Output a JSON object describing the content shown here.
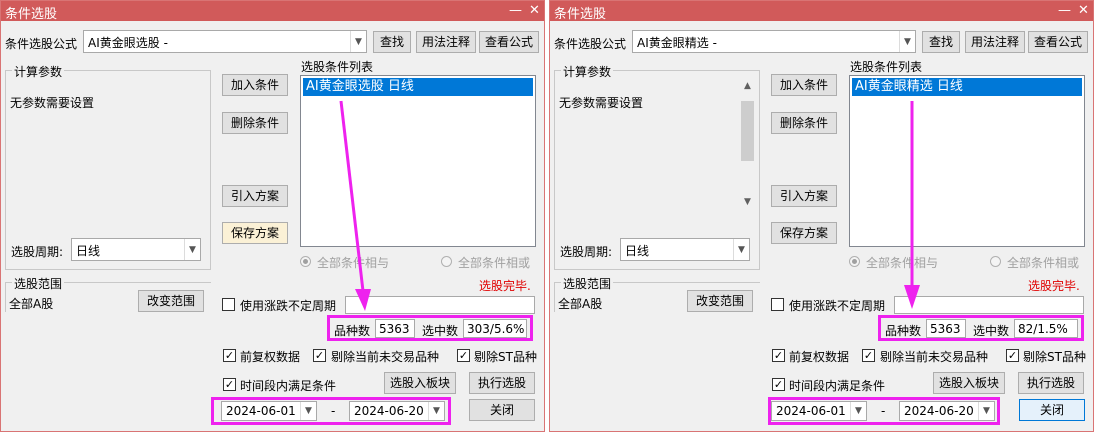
{
  "windows": [
    {
      "title": "条件选股",
      "formula_label": "条件选股公式",
      "formula_value": "AI黄金眼选股  -",
      "btn_find": "查找",
      "btn_usage": "用法注释",
      "btn_view": "查看公式",
      "calc_params_title": "计算参数",
      "no_params": "无参数需要设置",
      "btn_add": "加入条件",
      "btn_delete": "删除条件",
      "btn_import": "引入方案",
      "btn_save": "保存方案",
      "list_title": "选股条件列表",
      "list_item": "AI黄金眼选股  日线",
      "period_label": "选股周期:",
      "period_value": "日线",
      "radio_and": "全部条件相与",
      "radio_or": "全部条件相或",
      "status": "选股完毕.",
      "scope_title": "选股范围",
      "scope_value": "全部A股",
      "btn_change_scope": "改变范围",
      "use_float_period": "使用涨跌不定周期",
      "count_label": "品种数",
      "count_value": "5363",
      "selected_label": "选中数",
      "selected_value": "303/5.6%",
      "opt_fq": "前复权数据",
      "opt_untraded": "剔除当前未交易品种",
      "opt_st": "剔除ST品种",
      "opt_timerange": "时间段内满足条件",
      "btn_to_block": "选股入板块",
      "btn_execute": "执行选股",
      "date_from": "2024-06-01",
      "date_sep": "-",
      "date_to": "2024-06-20",
      "btn_close": "关闭"
    },
    {
      "title": "条件选股",
      "formula_label": "条件选股公式",
      "formula_value": "AI黄金眼精选  -",
      "btn_find": "查找",
      "btn_usage": "用法注释",
      "btn_view": "查看公式",
      "calc_params_title": "计算参数",
      "no_params": "无参数需要设置",
      "btn_add": "加入条件",
      "btn_delete": "删除条件",
      "btn_import": "引入方案",
      "btn_save": "保存方案",
      "list_title": "选股条件列表",
      "list_item": "AI黄金眼精选  日线",
      "period_label": "选股周期:",
      "period_value": "日线",
      "radio_and": "全部条件相与",
      "radio_or": "全部条件相或",
      "status": "选股完毕.",
      "scope_title": "选股范围",
      "scope_value": "全部A股",
      "btn_change_scope": "改变范围",
      "use_float_period": "使用涨跌不定周期",
      "count_label": "品种数",
      "count_value": "5363",
      "selected_label": "选中数",
      "selected_value": "82/1.5%",
      "opt_fq": "前复权数据",
      "opt_untraded": "剔除当前未交易品种",
      "opt_st": "剔除ST品种",
      "opt_timerange": "时间段内满足条件",
      "btn_to_block": "选股入板块",
      "btn_execute": "执行选股",
      "date_from": "2024-06-01",
      "date_sep": "-",
      "date_to": "2024-06-20",
      "btn_close": "关闭"
    }
  ],
  "colors": {
    "titlebar": "#d15a5a",
    "highlight_annotation": "#ee22ee",
    "list_selection": "#0078d7",
    "status_red": "#e00000"
  },
  "icons": {
    "minimize": "minimize-icon",
    "close": "close-icon",
    "dropdown": "chevron-down-icon",
    "annotation_arrow": "arrow-annotation-icon"
  }
}
